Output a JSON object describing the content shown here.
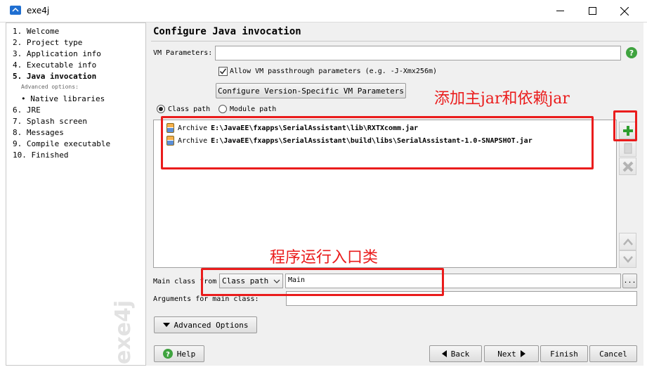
{
  "window": {
    "title": "exe4j",
    "minimize_symbol": "—",
    "maximize_symbol": "☐",
    "close_symbol": "✕"
  },
  "sidebar": {
    "steps": [
      {
        "label": "1.  Welcome"
      },
      {
        "label": "2.  Project type"
      },
      {
        "label": "3.  Application info"
      },
      {
        "label": "4.  Executable info"
      },
      {
        "label": "5.  Java invocation",
        "active": true
      },
      {
        "label": "Advanced options:",
        "sub": true
      },
      {
        "label": "• Native libraries"
      },
      {
        "label": "6.  JRE"
      },
      {
        "label": "7.  Splash screen"
      },
      {
        "label": "8.  Messages"
      },
      {
        "label": "9.  Compile executable"
      },
      {
        "label": "10.  Finished"
      }
    ],
    "watermark": "exe4j"
  },
  "main": {
    "title": "Configure Java invocation",
    "vm_parameters_label": "VM Parameters:",
    "vm_parameters_value": "",
    "help_symbol": "?",
    "passthrough_label": "Allow VM passthrough parameters (e.g. -J-Xmx256m)",
    "passthrough_checked": true,
    "configure_vm_button": "Configure Version-Specific VM Parameters",
    "class_path_radio": "Class path",
    "module_path_radio": "Module path",
    "selected_path_mode": "Class path",
    "classpath_entries": [
      {
        "type": "Archive",
        "path": "E:\\JavaEE\\fxapps\\SerialAssistant\\lib\\RXTXcomm.jar"
      },
      {
        "type": "Archive",
        "path": "E:\\JavaEE\\fxapps\\SerialAssistant\\build\\libs\\SerialAssistant-1.0-SNAPSHOT.jar"
      }
    ],
    "main_class_from_label": "Main class from",
    "main_class_from_value": "Class path",
    "main_class_value": "Main",
    "browse_label": "...",
    "arguments_label": "Arguments for main class:",
    "arguments_value": "",
    "advanced_options_button": "Advanced Options"
  },
  "footer": {
    "help": "Help",
    "back": "Back",
    "next": "Next",
    "finish": "Finish",
    "cancel": "Cancel"
  },
  "annotations": {
    "add_jar_note": "添加主jar和依赖jar",
    "entry_class_note": "程序运行入口类",
    "color": "#ea1c1c"
  },
  "colors": {
    "add_icon": "#2e9e2e",
    "help_icon": "#3fa33f"
  }
}
